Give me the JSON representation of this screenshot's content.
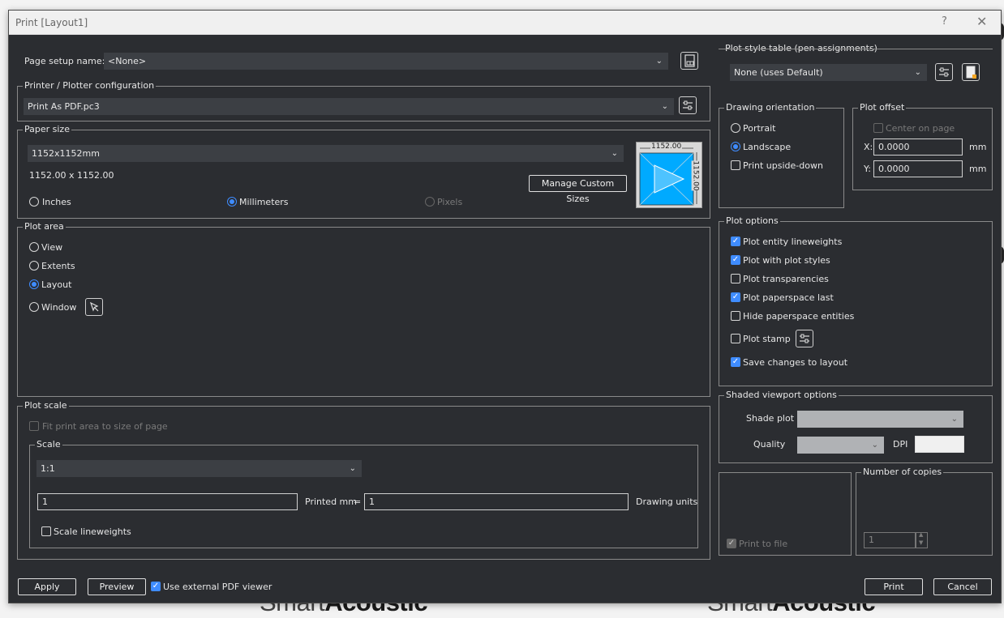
{
  "window": {
    "title": "Print [Layout1]",
    "help": "?",
    "close": "✕"
  },
  "background": {
    "left_light": "Smart",
    "left_bold": "Acoustic",
    "right_light": "Smart",
    "right_bold": "Acoustic"
  },
  "page_setup": {
    "label": "Page setup name:",
    "value": "<None>"
  },
  "printer": {
    "legend": "Printer / Plotter configuration",
    "value": "Print As PDF.pc3"
  },
  "paper": {
    "legend": "Paper size",
    "value": "1152x1152mm",
    "dimensions": "1152.00 x 1152.00",
    "manage_btn": "Manage Custom Sizes",
    "units": {
      "inches": "Inches",
      "millimeters": "Millimeters",
      "pixels": "Pixels",
      "selected": "millimeters"
    },
    "preview_w": "1152.00",
    "preview_h": "1152.00"
  },
  "plot_area": {
    "legend": "Plot area",
    "options": {
      "view": "View",
      "extents": "Extents",
      "layout": "Layout",
      "window": "Window"
    },
    "selected": "layout"
  },
  "plot_scale": {
    "legend": "Plot scale",
    "fit_label": "Fit print area to size of page",
    "scale_legend": "Scale",
    "scale_value": "1:1",
    "printed": "1",
    "printed_label": "Printed mm",
    "equals": "=",
    "drawing": "1",
    "drawing_label": "Drawing units",
    "lineweights_label": "Scale lineweights"
  },
  "plot_style": {
    "legend": "Plot style table (pen assignments)",
    "value": "None (uses Default)"
  },
  "orientation": {
    "legend": "Drawing orientation",
    "portrait": "Portrait",
    "landscape": "Landscape",
    "upside_down": "Print upside-down",
    "selected": "landscape"
  },
  "offset": {
    "legend": "Plot offset",
    "center_label": "Center on page",
    "x_label": "X:",
    "x_value": "0.0000",
    "x_unit": "mm",
    "y_label": "Y:",
    "y_value": "0.0000",
    "y_unit": "mm"
  },
  "plot_options": {
    "legend": "Plot options",
    "items": [
      {
        "label": "Plot entity lineweights",
        "checked": true
      },
      {
        "label": "Plot with plot styles",
        "checked": true
      },
      {
        "label": "Plot transparencies",
        "checked": false
      },
      {
        "label": "Plot paperspace last",
        "checked": true
      },
      {
        "label": "Hide paperspace entities",
        "checked": false
      },
      {
        "label": "Plot stamp",
        "checked": false
      },
      {
        "label": "Save changes to layout",
        "checked": true
      }
    ]
  },
  "shaded": {
    "legend": "Shaded viewport options",
    "shade_label": "Shade plot",
    "quality_label": "Quality",
    "dpi_label": "DPI"
  },
  "print_to_file": {
    "label": "Print to file"
  },
  "copies": {
    "legend": "Number of copies",
    "value": "1"
  },
  "footer": {
    "apply": "Apply",
    "preview": "Preview",
    "external_viewer": "Use external PDF viewer",
    "print": "Print",
    "cancel": "Cancel"
  },
  "colors": {
    "accent": "#3f8cff",
    "dialog_bg": "#2b2d31",
    "field_bg": "#3c3f44",
    "preview_blue": "#00aaff"
  }
}
